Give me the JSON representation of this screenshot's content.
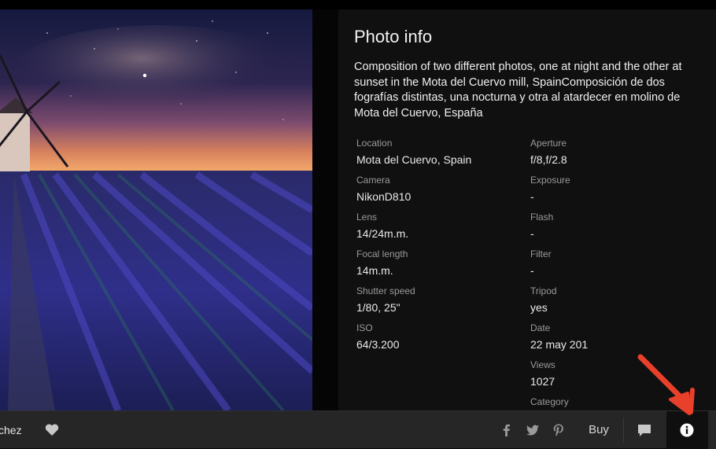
{
  "info": {
    "title": "Photo info",
    "description": "Composition of two different photos, one at night and the other at sunset in the Mota del Cuervo mill, SpainComposición de dos fografías distintas, una nocturna y otra al atardecer en molino de Mota del Cuervo, España",
    "left_column": [
      {
        "label": "Location",
        "value": "Mota del Cuervo, Spain"
      },
      {
        "label": "Camera",
        "value": "NikonD810"
      },
      {
        "label": "Lens",
        "value": "14/24m.m."
      },
      {
        "label": "Focal length",
        "value": "14m.m."
      },
      {
        "label": "Shutter speed",
        "value": "1/80, 25\""
      },
      {
        "label": "ISO",
        "value": "64/3.200"
      }
    ],
    "right_column": [
      {
        "label": "Aperture",
        "value": "f/8,f/2.8"
      },
      {
        "label": "Exposure",
        "value": "-"
      },
      {
        "label": "Flash",
        "value": "-"
      },
      {
        "label": "Filter",
        "value": "-"
      },
      {
        "label": "Tripod",
        "value": "yes"
      },
      {
        "label": "Date",
        "value": "22 may 201"
      },
      {
        "label": "Views",
        "value": "1027"
      },
      {
        "label": "Category",
        "value": ""
      }
    ]
  },
  "bottombar": {
    "author": "chez",
    "buy_label": "Buy",
    "icons": {
      "like": "heart-icon",
      "facebook": "facebook-icon",
      "twitter": "twitter-icon",
      "pinterest": "pinterest-icon",
      "comment": "comment-icon",
      "info": "info-icon"
    }
  },
  "colors": {
    "annotation": "#e8402a",
    "panel_bg": "#101010",
    "bar_bg": "#262626"
  }
}
